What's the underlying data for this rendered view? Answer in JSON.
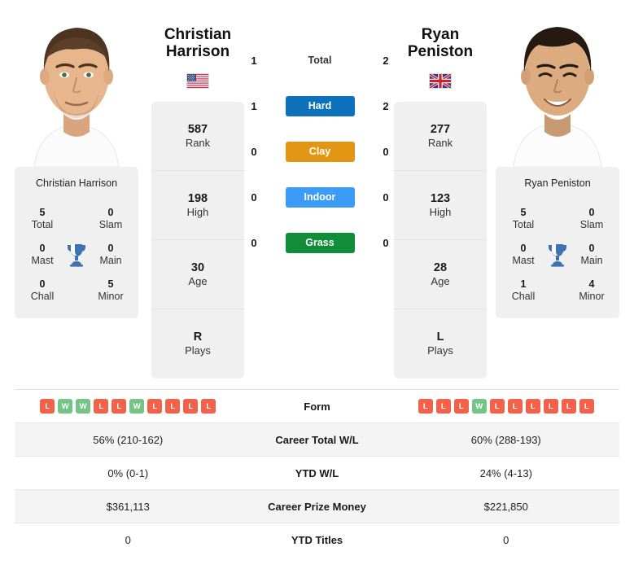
{
  "players": {
    "left": {
      "first_name": "Christian",
      "last_name": "Harrison",
      "full_name": "Christian Harrison",
      "flag": "us-flag-icon",
      "rank": "587",
      "rank_label": "Rank",
      "high": "198",
      "high_label": "High",
      "age": "30",
      "age_label": "Age",
      "plays": "R",
      "plays_label": "Plays",
      "titles": {
        "total": "5",
        "total_label": "Total",
        "slam": "0",
        "slam_label": "Slam",
        "mast": "0",
        "mast_label": "Mast",
        "main": "0",
        "main_label": "Main",
        "chall": "0",
        "chall_label": "Chall",
        "minor": "5",
        "minor_label": "Minor"
      },
      "form": [
        "L",
        "W",
        "W",
        "L",
        "L",
        "W",
        "L",
        "L",
        "L",
        "L"
      ],
      "career_total_wl": "56% (210-162)",
      "ytd_wl": "0% (0-1)",
      "career_prize_money": "$361,113",
      "ytd_titles": "0"
    },
    "right": {
      "first_name": "Ryan",
      "last_name": "Peniston",
      "full_name": "Ryan Peniston",
      "flag": "gb-flag-icon",
      "rank": "277",
      "rank_label": "Rank",
      "high": "123",
      "high_label": "High",
      "age": "28",
      "age_label": "Age",
      "plays": "L",
      "plays_label": "Plays",
      "titles": {
        "total": "5",
        "total_label": "Total",
        "slam": "0",
        "slam_label": "Slam",
        "mast": "0",
        "mast_label": "Mast",
        "main": "0",
        "main_label": "Main",
        "chall": "1",
        "chall_label": "Chall",
        "minor": "4",
        "minor_label": "Minor"
      },
      "form": [
        "L",
        "L",
        "L",
        "W",
        "L",
        "L",
        "L",
        "L",
        "L",
        "L"
      ],
      "career_total_wl": "60% (288-193)",
      "ytd_wl": "24% (4-13)",
      "career_prize_money": "$221,850",
      "ytd_titles": "0"
    }
  },
  "head_to_head": [
    {
      "label": "Total",
      "left": "1",
      "right": "2",
      "color": "",
      "style": "plain"
    },
    {
      "label": "Hard",
      "left": "1",
      "right": "2",
      "color": "#0d72bb",
      "style": "badge"
    },
    {
      "label": "Clay",
      "left": "0",
      "right": "0",
      "color": "#e39613",
      "style": "badge"
    },
    {
      "label": "Indoor",
      "left": "0",
      "right": "0",
      "color": "#3b9cf7",
      "style": "badge"
    },
    {
      "label": "Grass",
      "left": "0",
      "right": "0",
      "color": "#118c39",
      "style": "badge"
    }
  ],
  "table_rows": [
    {
      "label": "Form",
      "key": "form",
      "type": "form"
    },
    {
      "label": "Career Total W/L",
      "key": "career_total_wl",
      "type": "text"
    },
    {
      "label": "YTD W/L",
      "key": "ytd_wl",
      "type": "text"
    },
    {
      "label": "Career Prize Money",
      "key": "career_prize_money",
      "type": "text"
    },
    {
      "label": "YTD Titles",
      "key": "ytd_titles",
      "type": "text"
    }
  ],
  "colors": {
    "win": "#74c486",
    "loss": "#f26149",
    "card_bg": "#f0f0f0",
    "row_alt": "#f4f4f4"
  }
}
